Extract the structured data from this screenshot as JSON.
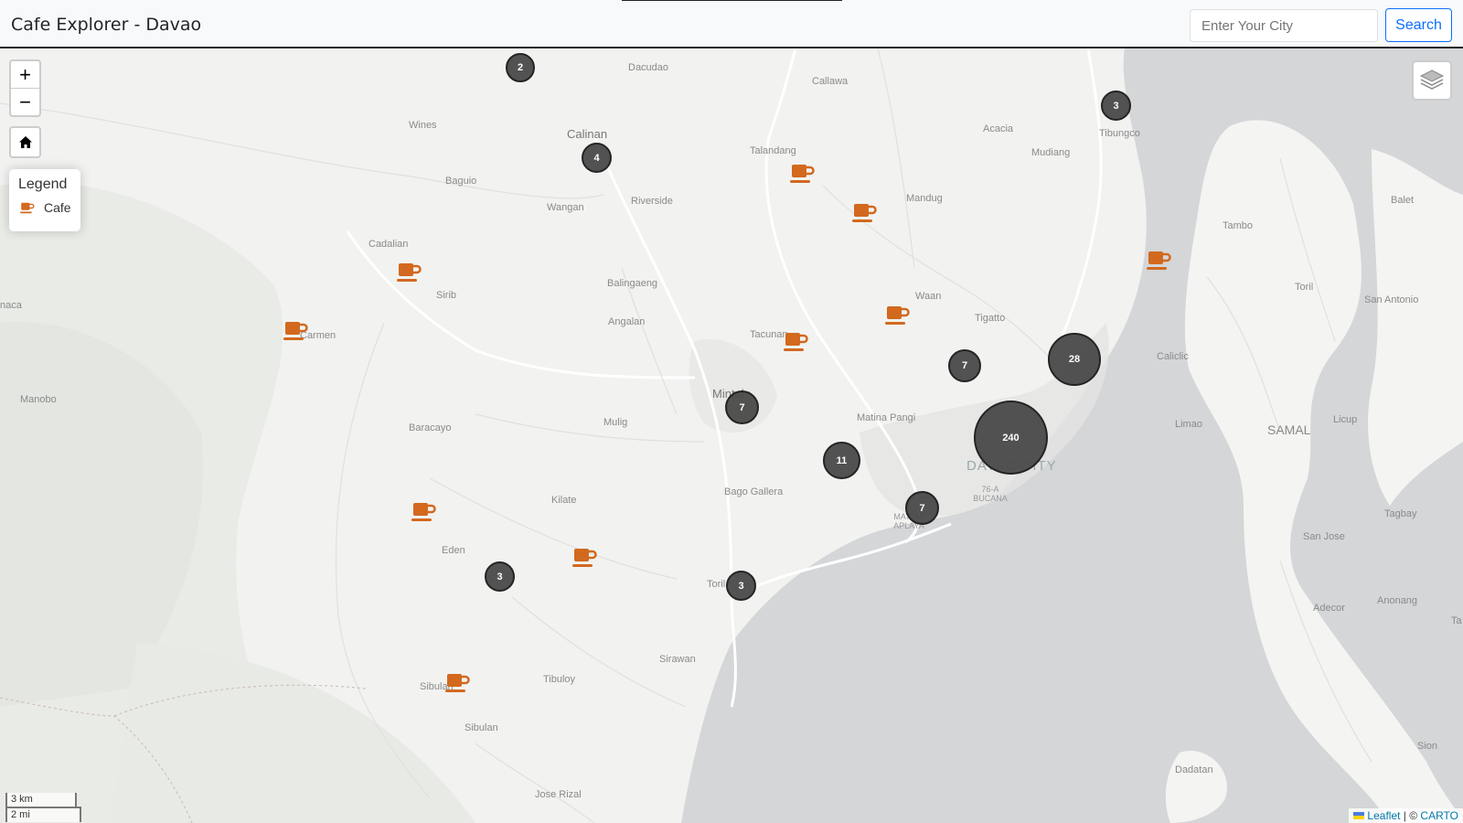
{
  "app": {
    "title": "Cafe Explorer - Davao",
    "search_placeholder": "Enter Your City",
    "search_label": "Search"
  },
  "map_controls": {
    "zoom_in": "+",
    "zoom_out": "−",
    "home_icon": "home-icon",
    "layers_icon": "layers-icon"
  },
  "legend": {
    "title": "Legend",
    "item_label": "Cafe",
    "item_icon": "coffee-cup-icon",
    "icon_color": "#d2691e"
  },
  "clusters": [
    "2",
    "4",
    "3",
    "28",
    "7",
    "240",
    "7",
    "11",
    "7",
    "3",
    "3"
  ],
  "places": {
    "dacudao": "Dacudao",
    "callawa": "Callawa",
    "calinan": "Calinan",
    "wines": "Wines",
    "acacia": "Acacia",
    "tibungco": "Tibungco",
    "mudiang": "Mudiang",
    "talandang": "Talandang",
    "baguio": "Baguio",
    "riverside": "Riverside",
    "wangan": "Wangan",
    "mandug": "Mandug",
    "balet": "Balet",
    "tambo": "Tambo",
    "cadalian": "Cadalian",
    "sirib": "Sirib",
    "balingaeng": "Balingaeng",
    "waan": "Waan",
    "toril_right": "Toril",
    "san_antonio": "San Antonio",
    "naca": "naca",
    "carmen": "Carmen",
    "angalan": "Angalan",
    "tacunan": "Tacunan",
    "tigatto": "Tigatto",
    "caliclic": "Caliclic",
    "manobo": "Manobo",
    "mintal": "Mintal",
    "baracayo": "Baracayo",
    "mulig": "Mulig",
    "matina_pangi": "Matina Pangi",
    "limao": "Limao",
    "samal": "SAMAL",
    "licup": "Licup",
    "davao_city": "DAVAO CITY",
    "bucana": "76-A BUCANA",
    "bago_gallera": "Bago Gallera",
    "kilate": "Kilate",
    "tagbay": "Tagbay",
    "matina_aplaya": "MATINA APLAYA",
    "eden": "Eden",
    "san_jose": "San Jose",
    "toril": "Toril",
    "adecor": "Adecor",
    "anonang": "Anonang",
    "ta": "Ta",
    "sirawan": "Sirawan",
    "tibuloy": "Tibuloy",
    "sibulan_top": "Sibulan",
    "sibulan": "Sibulan",
    "datadan": "Dadatan",
    "sion": "Sion",
    "jose_rizal": "Jose Rizal"
  },
  "scale": {
    "km": "3 km",
    "mi": "2 mi"
  },
  "attribution": {
    "leaflet": "Leaflet",
    "separator": " | © ",
    "carto": "CARTO"
  }
}
